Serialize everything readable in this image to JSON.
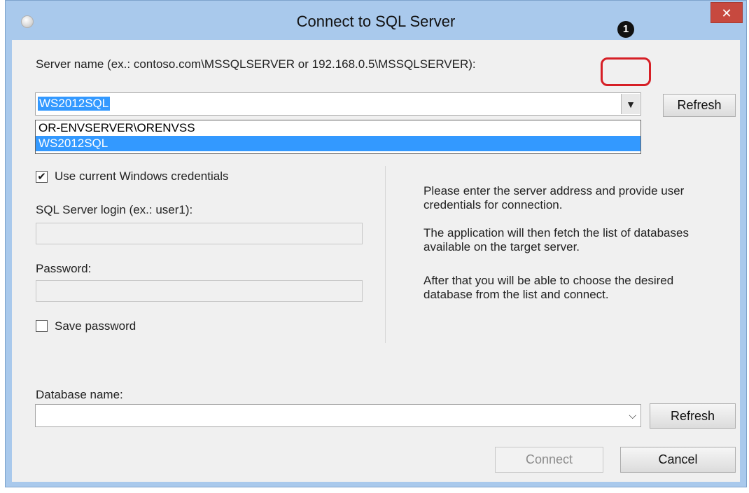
{
  "window": {
    "title": "Connect to SQL Server",
    "close_glyph": "✕"
  },
  "server": {
    "label": "Server name (ex.: contoso.com\\MSSQLSERVER or 192.168.0.5\\MSSQLSERVER):",
    "value": "WS2012SQL",
    "dropdown_arrow": "chevron-down-icon",
    "refresh_label": "Refresh",
    "options": [
      "OR-ENVSERVER\\ORENVSS",
      "WS2012SQL"
    ],
    "selected_index": 1
  },
  "auth": {
    "use_windows_credentials_label": "Use current Windows credentials",
    "use_windows_credentials_checked": true,
    "login_label": "SQL Server login (ex.: user1):",
    "login_value": "",
    "password_label": "Password:",
    "password_value": "",
    "save_password_label": "Save password",
    "save_password_checked": false
  },
  "info": {
    "p1": "Please enter the server address and provide user credentials for connection.",
    "p2": "The application will then fetch the list of databases available on the target server.",
    "p3": "After that you will be able to choose the desired database from the list and connect."
  },
  "database": {
    "label": "Database name:",
    "value": "",
    "refresh_label": "Refresh"
  },
  "footer": {
    "connect_label": "Connect",
    "cancel_label": "Cancel"
  },
  "annotation": {
    "badge": "1",
    "color": "#d61f26"
  },
  "colors": {
    "frame": "#a9c9ec",
    "selection": "#3399ff",
    "close": "#c7493f"
  }
}
